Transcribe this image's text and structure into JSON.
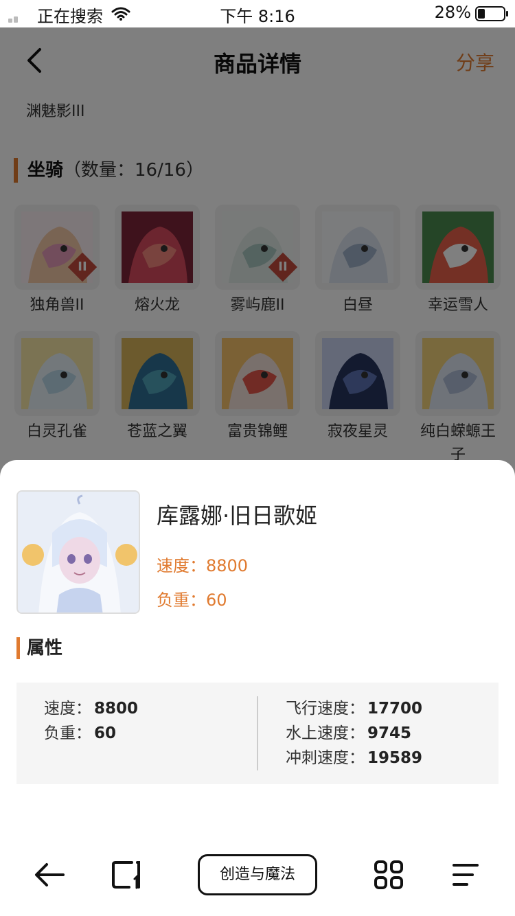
{
  "status_bar": {
    "carrier": "正在搜索",
    "time": "下午 8:16",
    "battery": "28%",
    "battery_level": 0.28
  },
  "nav": {
    "back_icon": "chevron-left-icon",
    "title": "商品详情",
    "share_label": "分享",
    "accent_color": "#e07a2f"
  },
  "owner_name": "渊魅影III",
  "mounts_section": {
    "title": "坐骑",
    "count_text": "（数量：16/16）"
  },
  "mounts": [
    {
      "label": "独角兽II",
      "tag": "II",
      "palette": [
        "#f3c9a7",
        "#e59ab8",
        "#fbeef2"
      ]
    },
    {
      "label": "熔火龙",
      "tag": "",
      "palette": [
        "#d94a5e",
        "#f2877c",
        "#7d2438"
      ]
    },
    {
      "label": "雾屿鹿II",
      "tag": "II",
      "palette": [
        "#dfe9e4",
        "#a9c7c0",
        "#f0f5f2"
      ]
    },
    {
      "label": "白昼",
      "tag": "",
      "palette": [
        "#dbe3ee",
        "#9fb1c8",
        "#f6f8fb"
      ]
    },
    {
      "label": "幸运雪人",
      "tag": "",
      "palette": [
        "#e8614a",
        "#ffffff",
        "#4a8b4f"
      ]
    },
    {
      "label": "白灵孔雀",
      "tag": "",
      "palette": [
        "#e6f1f6",
        "#b9d7e6",
        "#f7e7a7"
      ]
    },
    {
      "label": "苍蓝之翼",
      "tag": "",
      "palette": [
        "#2f6f95",
        "#4fa2b8",
        "#d9b45a"
      ]
    },
    {
      "label": "富贵锦鲤",
      "tag": "",
      "palette": [
        "#f3e0d8",
        "#e2574a",
        "#f7c26a"
      ]
    },
    {
      "label": "寂夜星灵",
      "tag": "",
      "palette": [
        "#26345e",
        "#5d73b5",
        "#c9d3f0"
      ]
    },
    {
      "label": "纯白蝾螈王子",
      "tag": "",
      "palette": [
        "#dfe7f2",
        "#aebcd6",
        "#f3d37a"
      ]
    }
  ],
  "detail": {
    "name": "库露娜·旧日歌姬",
    "speed_label": "速度：",
    "speed_value": "8800",
    "load_label": "负重：",
    "load_value": "60",
    "attr_title": "属性",
    "attrs_left": [
      {
        "label": "速度：",
        "value": "8800"
      },
      {
        "label": "负重：",
        "value": "60"
      }
    ],
    "attrs_right": [
      {
        "label": "飞行速度：",
        "value": "17700"
      },
      {
        "label": "水上速度：",
        "value": "9745"
      },
      {
        "label": "冲刺速度：",
        "value": "19589"
      }
    ]
  },
  "toolbar": {
    "back_icon": "arrow-left-icon",
    "tabs_icon": "tabs-icon",
    "center_label": "创造与魔法",
    "grid_icon": "apps-grid-icon",
    "menu_icon": "menu-icon"
  }
}
